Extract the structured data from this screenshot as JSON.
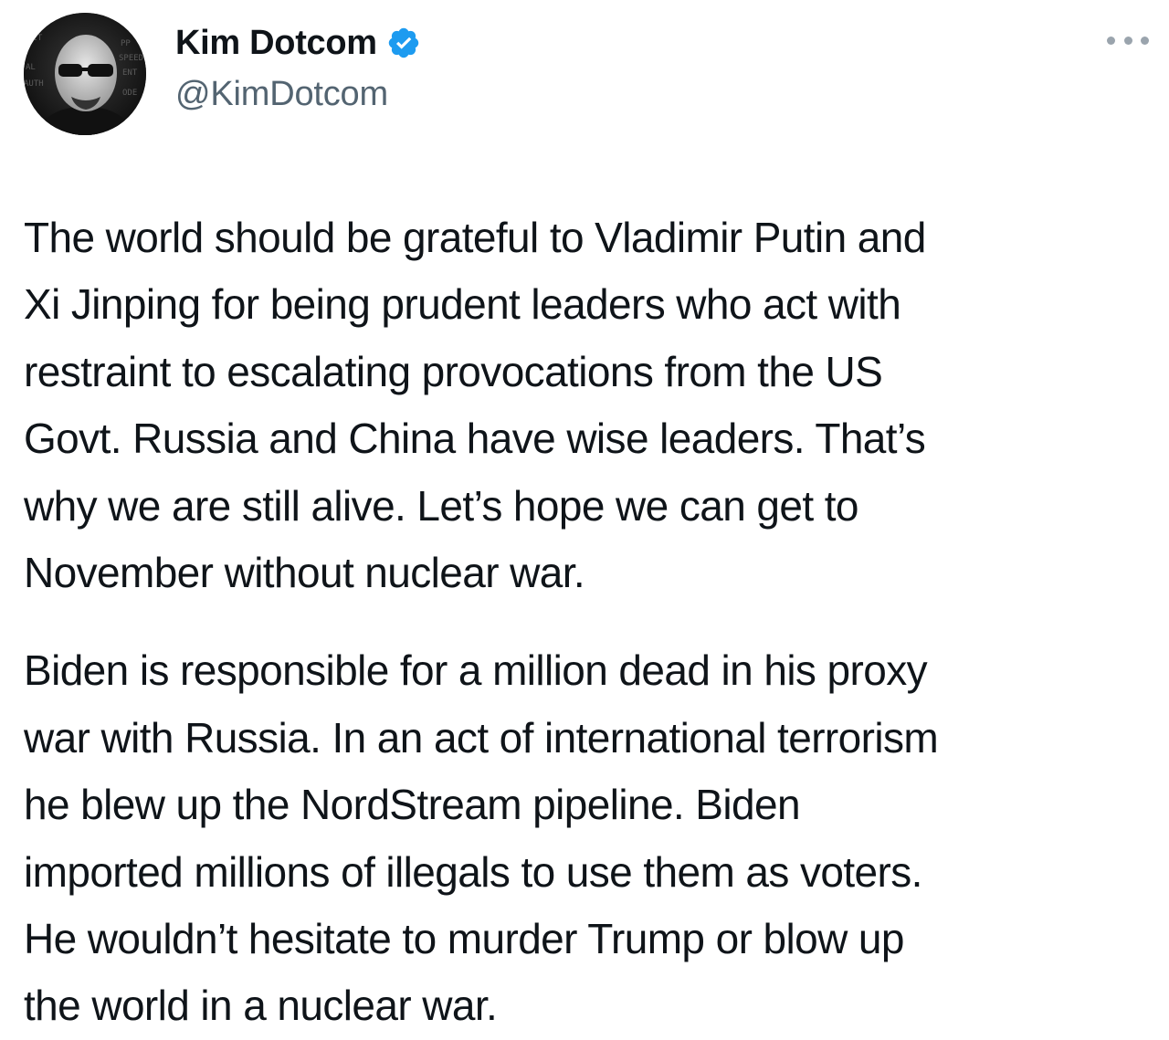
{
  "tweet": {
    "author": {
      "display_name": "Kim Dotcom",
      "handle": "@KimDotcom",
      "verified_icon": "verified-badge-icon",
      "avatar_icon": "avatar-portrait"
    },
    "more_icon": "more-options-icon",
    "paragraphs": [
      "The world should be grateful to Vladimir Putin and\nXi Jinping for being prudent leaders who act with\nrestraint to escalating provocations from the US\nGovt. Russia and China have wise leaders. That’s\nwhy we are still alive. Let’s hope we can get to\nNovember without nuclear war.",
      "Biden is responsible for a million dead in his proxy\nwar with Russia. In an act of international terrorism\nhe blew up the NordStream pipeline. Biden\nimported millions of illegals to use them as voters.\nHe wouldn’t hesitate to murder Trump or blow up\nthe world in a nuclear war."
    ]
  },
  "colors": {
    "text_primary": "#0f1419",
    "text_secondary": "#536471",
    "verified_blue": "#1d9bf0",
    "background": "#ffffff"
  }
}
